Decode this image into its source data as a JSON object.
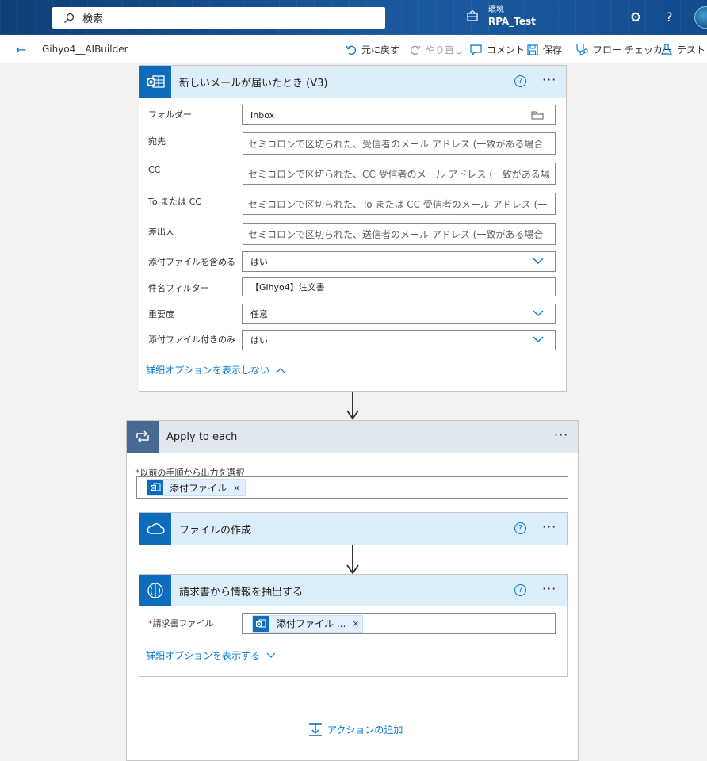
{
  "topbar": {
    "search_placeholder": "検索",
    "env_label": "環境",
    "env_name": "RPA_Test",
    "settings_icon": "gear-icon",
    "help_glyph": "?"
  },
  "cmdbar": {
    "flow_name": "Gihyo4__AIBuilder",
    "undo": "元に戻す",
    "redo": "やり直し",
    "comment": "コメント",
    "save": "保存",
    "checker": "フロー チェッカー",
    "test": "テスト"
  },
  "trigger": {
    "title": "新しいメールが届いたとき (V3)",
    "fields": [
      {
        "label": "フォルダー",
        "value": "Inbox"
      },
      {
        "label": "宛先",
        "value": "セミコロンで区切られた、受信者のメール アドレス (一致がある場合"
      },
      {
        "label": "CC",
        "value": "セミコロンで区切られた、CC 受信者のメール アドレス (一致がある場"
      },
      {
        "label": "To または CC",
        "value": "セミコロンで区切られた、To または CC 受信者のメール アドレス (一"
      },
      {
        "label": "差出人",
        "value": "セミコロンで区切られた、送信者のメール アドレス (一致がある場合"
      },
      {
        "label": "添付ファイルを含める",
        "value": "はい"
      },
      {
        "label": "件名フィルター",
        "value": "【Gihyo4】注文書"
      },
      {
        "label": "重要度",
        "value": "任意"
      },
      {
        "label": "添付ファイル付きのみ",
        "value": "はい"
      }
    ],
    "advanced_link": "詳細オプションを表示しない"
  },
  "apply": {
    "title": "Apply to each",
    "select_label": "以前の手順から出力を選択",
    "token": "添付ファイル",
    "token_remove": "×"
  },
  "create_file": {
    "title": "ファイルの作成"
  },
  "extract": {
    "title": "請求書から情報を抽出する",
    "field_label": "請求書ファイル",
    "token": "添付ファイル ...",
    "token_remove": "×",
    "advanced_link": "詳細オプションを表示する"
  },
  "add_action": "アクションの追加",
  "required_mark": "*",
  "more_glyph": "···",
  "help_q": "?",
  "colors": {
    "accent": "#0078d4",
    "tile": "#0f6cbd",
    "head": "#dceefa"
  }
}
